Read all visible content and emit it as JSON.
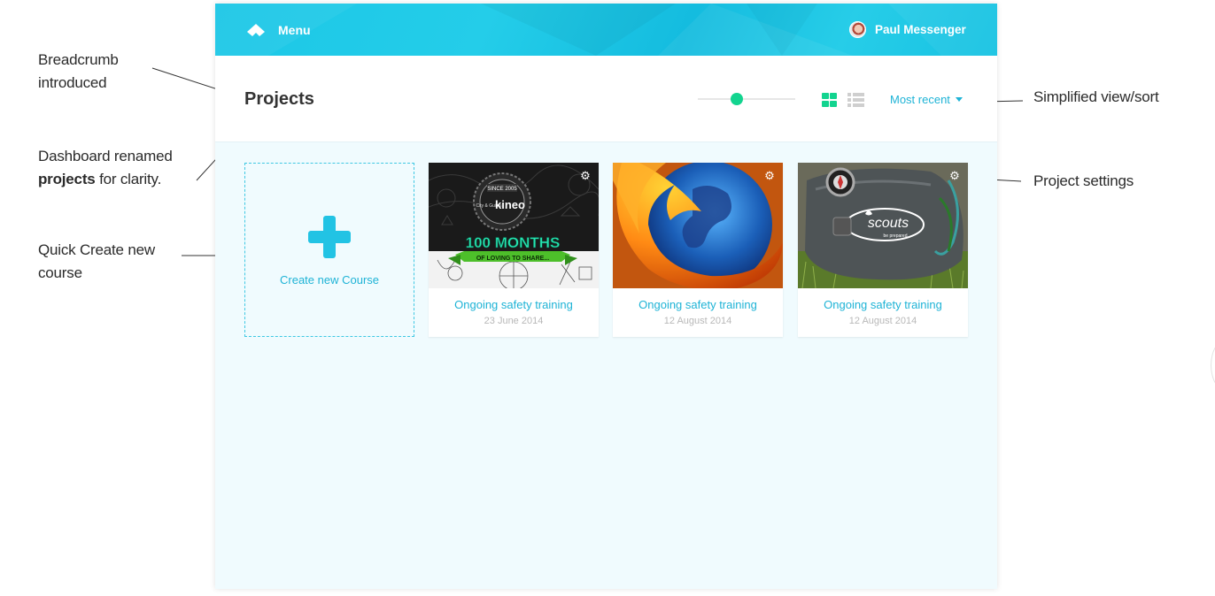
{
  "annotations": {
    "breadcrumb_line1": "Breadcrumb",
    "breadcrumb_line2": "introduced",
    "dashboard_line1": "Dashboard renamed",
    "dashboard_bold": "projects",
    "dashboard_rest": " for clarity.",
    "quick_line1": "Quick Create new",
    "quick_line2": "course",
    "simplified": "Simplified view/sort",
    "project_settings": "Project settings"
  },
  "topbar": {
    "menu_label": "Menu",
    "user_name": "Paul Messenger",
    "logo_icon": "logo-icon",
    "background": "#1cc7e6"
  },
  "header": {
    "title": "Projects",
    "sort_label": "Most recent",
    "slider_value": 0.4
  },
  "create_card": {
    "label": "Create new Course",
    "icon": "plus-icon"
  },
  "cards": [
    {
      "title": "Ongoing safety training",
      "date": "23 June 2014",
      "thumb": "kineo-100-months",
      "thumb_text_main": "100 MONTHS",
      "thumb_text_banner": "OF LOVING TO SHARE...",
      "thumb_badge_since": "SINCE 2005",
      "thumb_badge_brand": "kineo",
      "thumb_badge_cg": "City & Guilds"
    },
    {
      "title": "Ongoing safety training",
      "date": "12 August 2014",
      "thumb": "firefox-logo"
    },
    {
      "title": "Ongoing safety training",
      "date": "12 August 2014",
      "thumb": "scouts-bag",
      "thumb_brand": "scouts",
      "thumb_tagline": "be prepared"
    }
  ],
  "colors": {
    "accent": "#1eb3d6",
    "green": "#12d48f",
    "panel_bg": "#f0fbfe"
  }
}
